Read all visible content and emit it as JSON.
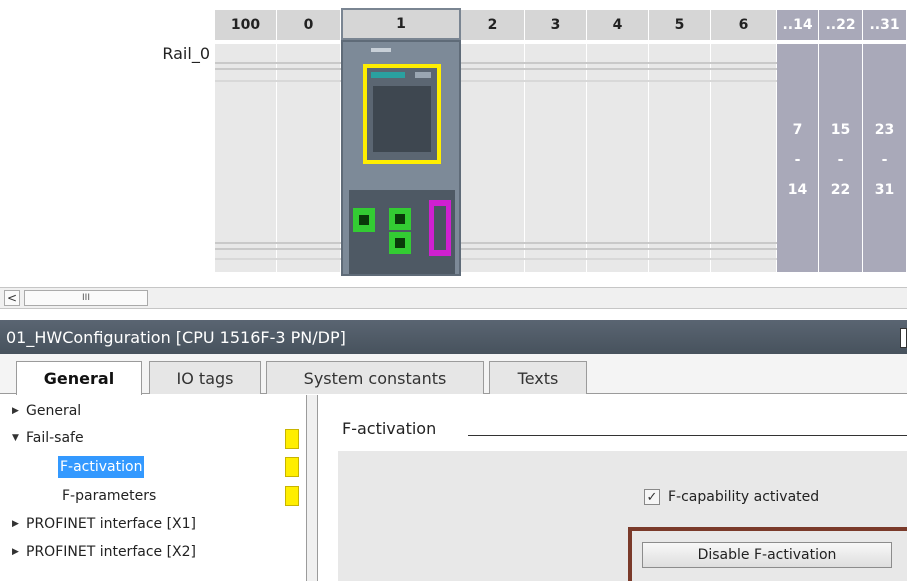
{
  "rack": {
    "rail_label": "Rail_0",
    "slot_headers": [
      "100",
      "0",
      "1",
      "2",
      "3",
      "4",
      "5",
      "6"
    ],
    "group_headers": [
      "..14",
      "..22",
      "..31"
    ],
    "group_ranges": [
      {
        "from": "7",
        "sep": "-",
        "to": "14"
      },
      {
        "from": "15",
        "sep": "-",
        "to": "22"
      },
      {
        "from": "23",
        "sep": "-",
        "to": "31"
      }
    ]
  },
  "scrollbar": {
    "left_arrow": "<",
    "thumb_grip": "III"
  },
  "inspector": {
    "title": "01_HWConfiguration [CPU 1516F-3 PN/DP]",
    "tabs": [
      {
        "label": "General"
      },
      {
        "label": "IO tags"
      },
      {
        "label": "System constants"
      },
      {
        "label": "Texts"
      }
    ],
    "tree": {
      "general": "General",
      "fail_safe": "Fail-safe",
      "f_activation": "F-activation",
      "f_parameters": "F-parameters",
      "profinet_x1": "PROFINET interface [X1]",
      "profinet_x2": "PROFINET interface [X2]"
    },
    "section_title": "F-activation",
    "checkbox_label": "F-capability activated",
    "checkbox_checked": true,
    "button_label": "Disable F-activation"
  },
  "colors": {
    "highlight_box": "#7a3a2a",
    "cpu_yellow": "#ffee00",
    "port_green": "#33cc33",
    "port_magenta": "#d020d0",
    "selection_blue": "#3399ff"
  }
}
